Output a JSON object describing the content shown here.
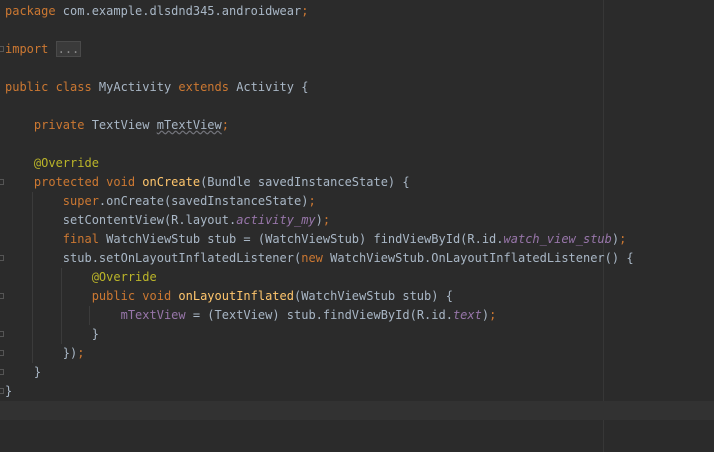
{
  "editor": {
    "lines": [
      {
        "tokens": [
          {
            "t": "package",
            "c": "kw"
          },
          {
            "t": " com.example.dlsdnd345.androidwear",
            "c": ""
          },
          {
            "t": ";",
            "c": "kw"
          }
        ]
      },
      {
        "tokens": []
      },
      {
        "fold": true,
        "tokens": [
          {
            "t": "import",
            "c": "kw"
          },
          {
            "t": " ",
            "c": ""
          },
          {
            "t": "...",
            "c": "collapsed"
          }
        ]
      },
      {
        "tokens": []
      },
      {
        "tokens": [
          {
            "t": "public class ",
            "c": "kw"
          },
          {
            "t": "MyActivity ",
            "c": ""
          },
          {
            "t": "extends ",
            "c": "kw"
          },
          {
            "t": "Activity {",
            "c": ""
          }
        ]
      },
      {
        "tokens": []
      },
      {
        "indent": 1,
        "tokens": [
          {
            "t": "    private ",
            "c": "kw"
          },
          {
            "t": "TextView ",
            "c": ""
          },
          {
            "t": "mTextView",
            "c": "unused"
          },
          {
            "t": ";",
            "c": "kw"
          }
        ]
      },
      {
        "tokens": []
      },
      {
        "indent": 1,
        "tokens": [
          {
            "t": "    @Override",
            "c": "ann"
          }
        ]
      },
      {
        "fold": true,
        "indent": 1,
        "tokens": [
          {
            "t": "    protected void ",
            "c": "kw"
          },
          {
            "t": "onCreate",
            "c": "fn"
          },
          {
            "t": "(Bundle savedInstanceState) {",
            "c": ""
          }
        ]
      },
      {
        "indent": 2,
        "tokens": [
          {
            "t": "        super",
            "c": "kw"
          },
          {
            "t": ".onCreate(savedInstanceState)",
            "c": ""
          },
          {
            "t": ";",
            "c": "kw"
          }
        ]
      },
      {
        "indent": 2,
        "tokens": [
          {
            "t": "        setContentView(R.layout.",
            "c": ""
          },
          {
            "t": "activity_my",
            "c": "it"
          },
          {
            "t": ")",
            "c": ""
          },
          {
            "t": ";",
            "c": "kw"
          }
        ]
      },
      {
        "indent": 2,
        "tokens": [
          {
            "t": "        final ",
            "c": "kw"
          },
          {
            "t": "WatchViewStub stub = (WatchViewStub) findViewById(R.id.",
            "c": ""
          },
          {
            "t": "watch_view_stub",
            "c": "it"
          },
          {
            "t": ")",
            "c": ""
          },
          {
            "t": ";",
            "c": "kw"
          }
        ]
      },
      {
        "fold": true,
        "indent": 2,
        "tokens": [
          {
            "t": "        stub.setOnLayoutInflatedListener(",
            "c": ""
          },
          {
            "t": "new ",
            "c": "kw"
          },
          {
            "t": "WatchViewStub.OnLayoutInflatedListener() {",
            "c": ""
          }
        ]
      },
      {
        "indent": 3,
        "tokens": [
          {
            "t": "            @Override",
            "c": "ann"
          }
        ]
      },
      {
        "fold": true,
        "indent": 3,
        "tokens": [
          {
            "t": "            public void ",
            "c": "kw"
          },
          {
            "t": "onLayoutInflated",
            "c": "fn"
          },
          {
            "t": "(WatchViewStub stub) {",
            "c": ""
          }
        ]
      },
      {
        "indent": 4,
        "tokens": [
          {
            "t": "                mTextView",
            "c": "fld"
          },
          {
            "t": " = (TextView) stub.findViewById(R.id.",
            "c": ""
          },
          {
            "t": "text",
            "c": "it"
          },
          {
            "t": ")",
            "c": ""
          },
          {
            "t": ";",
            "c": "kw"
          }
        ]
      },
      {
        "fold": true,
        "indent": 3,
        "tokens": [
          {
            "t": "            }",
            "c": ""
          }
        ]
      },
      {
        "fold": true,
        "indent": 2,
        "tokens": [
          {
            "t": "        })",
            "c": ""
          },
          {
            "t": ";",
            "c": "kw"
          }
        ]
      },
      {
        "fold": true,
        "indent": 1,
        "tokens": [
          {
            "t": "    }",
            "c": ""
          }
        ]
      },
      {
        "fold": true,
        "tokens": [
          {
            "t": "}",
            "c": ""
          }
        ]
      },
      {
        "caret": true,
        "tokens": []
      },
      {
        "tokens": []
      },
      {
        "tokens": []
      }
    ]
  }
}
